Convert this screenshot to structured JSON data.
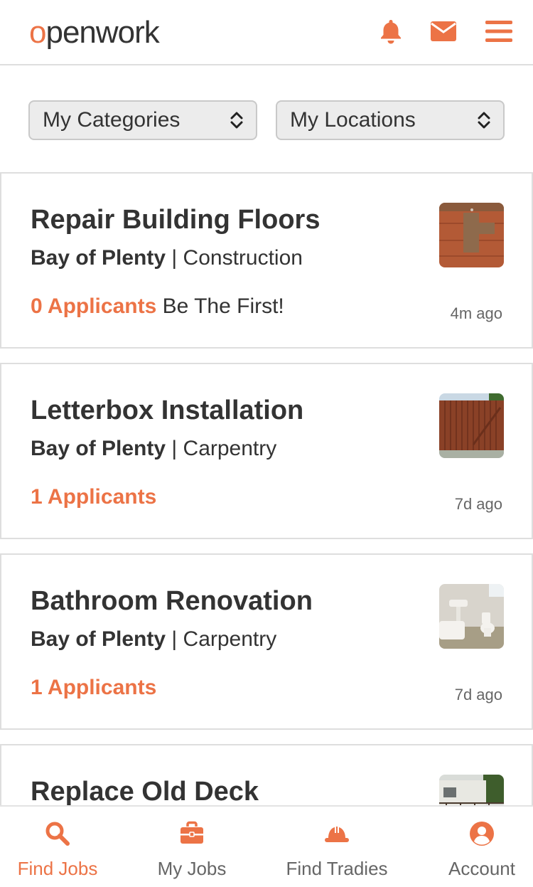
{
  "brand": {
    "logo_first": "o",
    "logo_rest": "penwork",
    "accent": "#ec7346"
  },
  "header": {
    "icons": [
      "bell-icon",
      "mail-icon",
      "menu-icon"
    ]
  },
  "filters": {
    "categories": "My Categories",
    "locations": "My Locations"
  },
  "jobs": [
    {
      "title": "Repair Building Floors",
      "region": "Bay of Plenty",
      "separator": " | ",
      "category": "Construction",
      "applicants": "0 Applicants",
      "extra": " Be The First!",
      "time": "4m ago",
      "thumb": "wood-floor"
    },
    {
      "title": "Letterbox Installation",
      "region": "Bay of Plenty",
      "separator": " | ",
      "category": "Carpentry",
      "applicants": "1 Applicants",
      "extra": "",
      "time": "7d ago",
      "thumb": "wooden-fence"
    },
    {
      "title": "Bathroom Renovation",
      "region": "Bay of Plenty",
      "separator": " | ",
      "category": "Carpentry",
      "applicants": "1 Applicants",
      "extra": "",
      "time": "7d ago",
      "thumb": "bathroom"
    },
    {
      "title": "Replace Old Deck",
      "thumb": "house-deck"
    }
  ],
  "nav": [
    {
      "label": "Find Jobs",
      "icon": "search-icon",
      "active": true
    },
    {
      "label": "My Jobs",
      "icon": "briefcase-icon",
      "active": false
    },
    {
      "label": "Find Tradies",
      "icon": "hard-hat-icon",
      "active": false
    },
    {
      "label": "Account",
      "icon": "account-icon",
      "active": false
    }
  ]
}
